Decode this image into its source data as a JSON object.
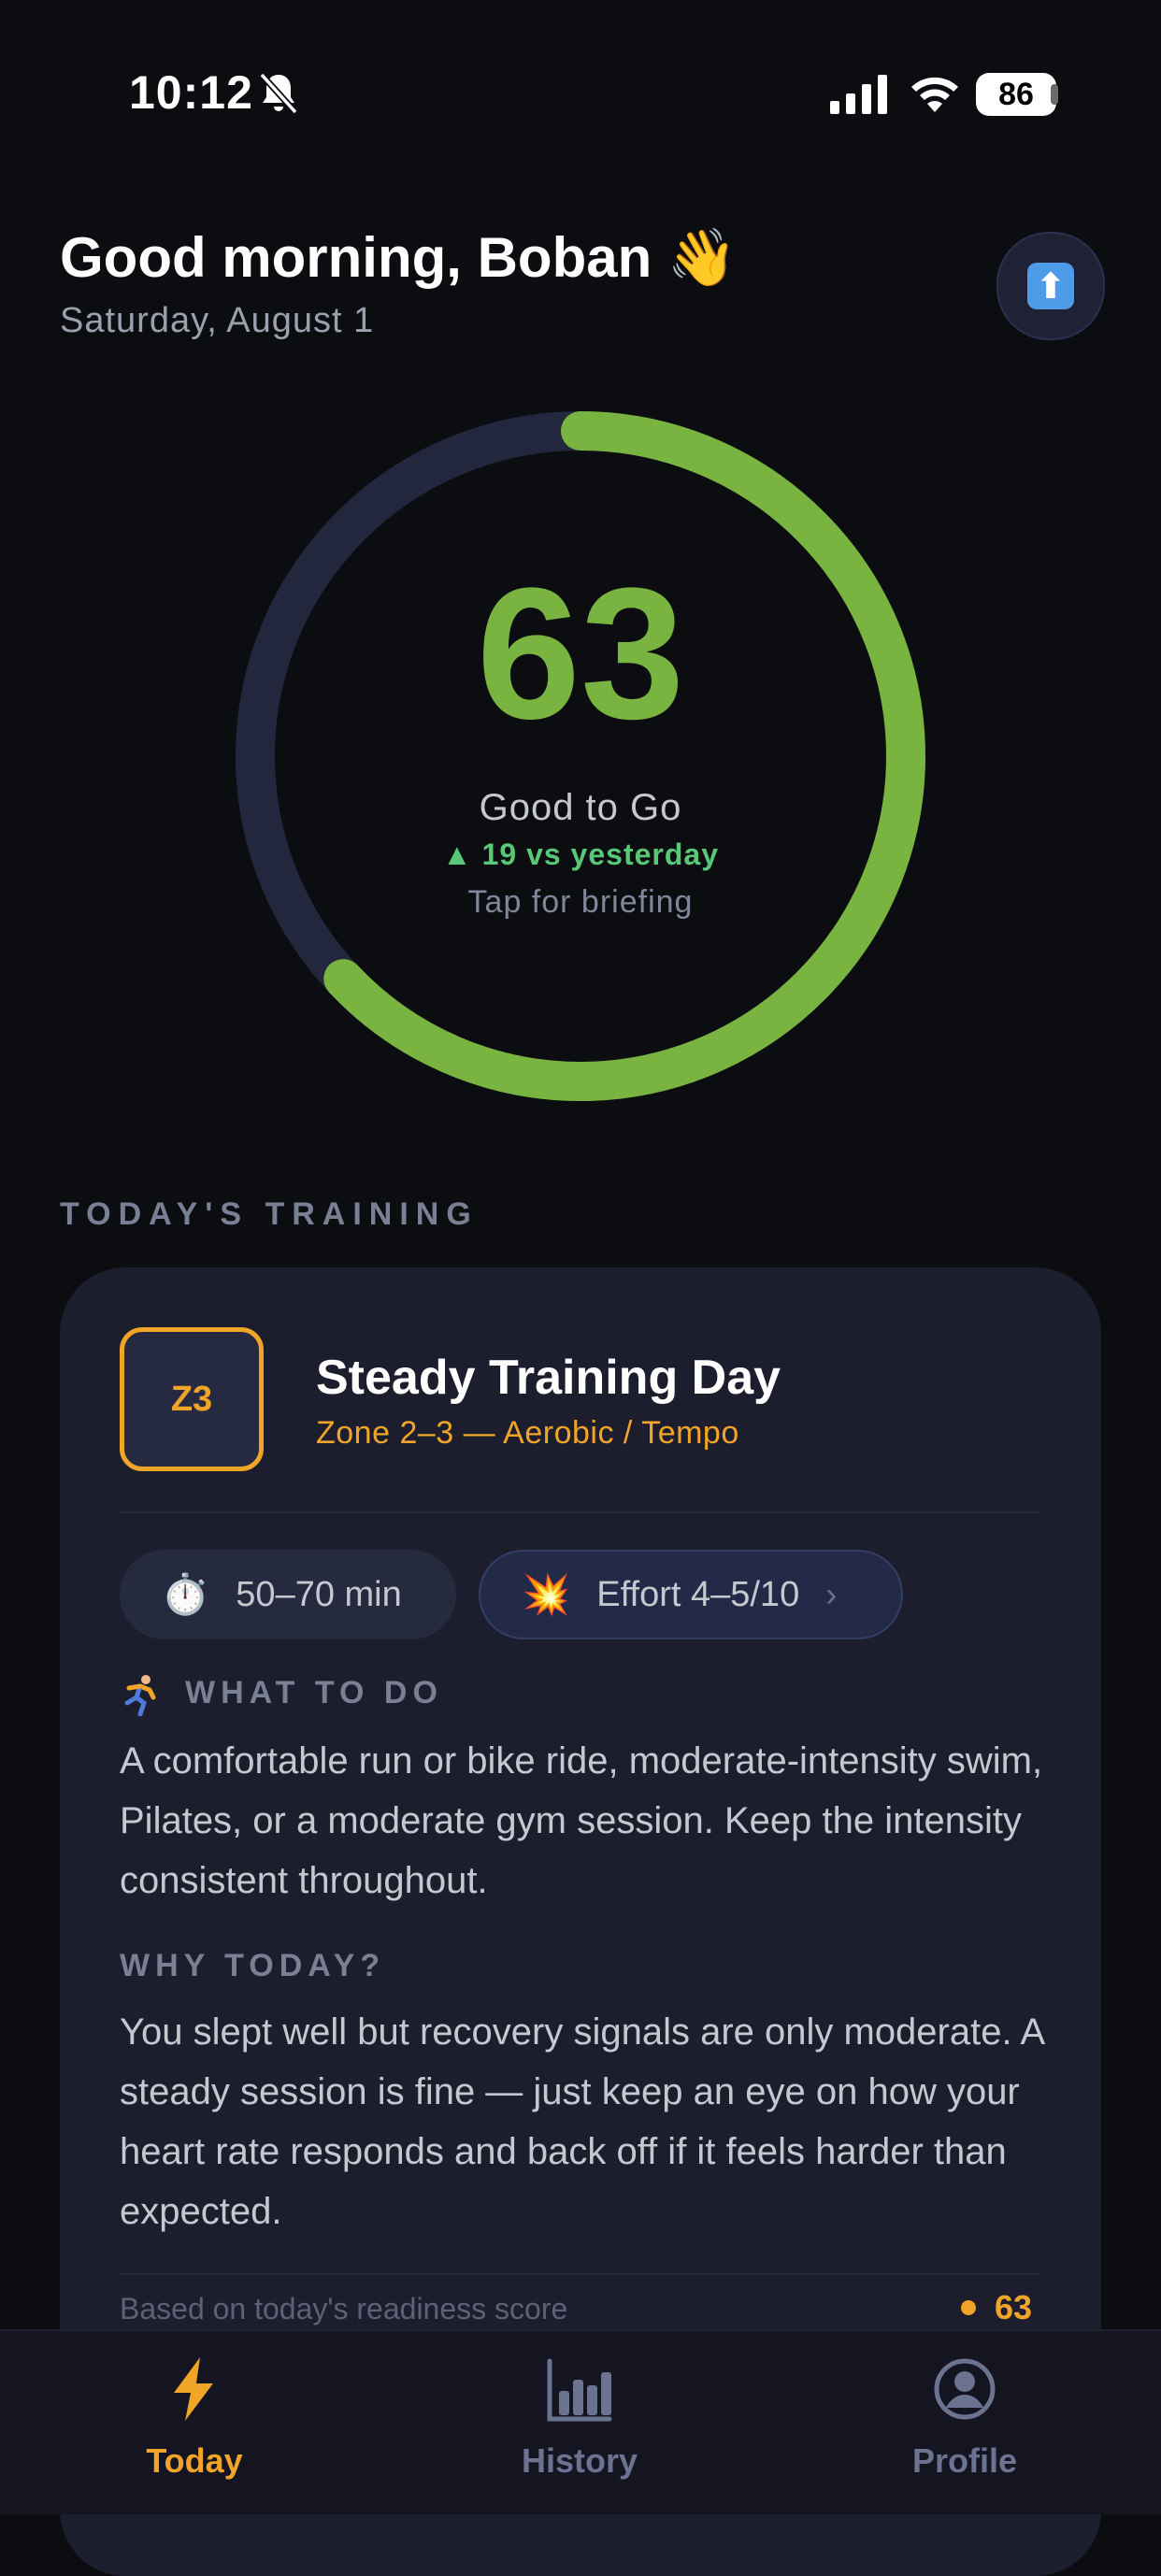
{
  "status_bar": {
    "time": "10:12",
    "battery": "86"
  },
  "header": {
    "greeting": "Good morning, Boban 👋",
    "date": "Saturday, August 1"
  },
  "readiness": {
    "score": "63",
    "score_fraction": 0.63,
    "label": "Good to Go",
    "delta": "▲ 19 vs yesterday",
    "hint": "Tap for briefing",
    "ring_color": "#78b43f",
    "track_color": "#23273d"
  },
  "training": {
    "section_title": "TODAY'S TRAINING",
    "zone_badge": "Z3",
    "title": "Steady Training Day",
    "subtitle": "Zone 2–3 — Aerobic / Tempo",
    "duration_emoji": "⏱️",
    "duration": "50–70 min",
    "effort_emoji": "💥",
    "effort": "Effort 4–5/10",
    "effort_chevron": "›",
    "what_title": "WHAT TO DO",
    "what_text": "A comfortable run or bike ride, moderate-intensity swim, Pilates, or a moderate gym session. Keep the intensity consistent throughout.",
    "why_title": "WHY TODAY?",
    "why_text": "You slept well but recovery signals are only moderate. A steady session is fine — just keep an eye on how your heart rate responds and back off if it feels harder than expected.",
    "based_on": "Based on today's readiness score",
    "based_score": "63",
    "accent": "#f0a428"
  },
  "tabs": [
    {
      "label": "Today",
      "icon": "bolt-icon",
      "active": true
    },
    {
      "label": "History",
      "icon": "bar-chart-icon",
      "active": false
    },
    {
      "label": "Profile",
      "icon": "user-circle-icon",
      "active": false
    }
  ]
}
